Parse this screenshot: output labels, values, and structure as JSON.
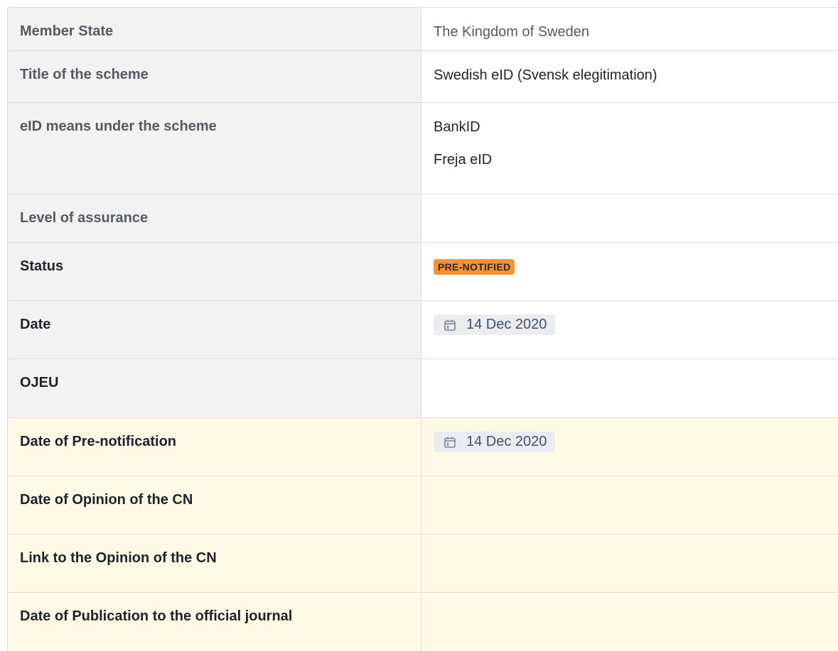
{
  "rows": [
    {
      "label": "Member State",
      "values": [
        "The Kingdom of Sweden"
      ]
    },
    {
      "label": "Title of the scheme",
      "values": [
        "Swedish eID (Svensk elegitimation)"
      ]
    },
    {
      "label": "eID means under the scheme",
      "values": [
        "BankID",
        "Freja eID"
      ]
    },
    {
      "label": "Level of assurance",
      "values": []
    },
    {
      "label": "Status",
      "status": "PRE-NOTIFIED"
    },
    {
      "label": "Date",
      "date": "14 Dec 2020"
    },
    {
      "label": "OJEU",
      "values": []
    },
    {
      "label": "Date of Pre-notification",
      "date": "14 Dec 2020"
    },
    {
      "label": "Date of Opinion of the CN",
      "values": []
    },
    {
      "label": "Link to the Opinion of the CN",
      "values": []
    },
    {
      "label": "Date of Publication to the official journal",
      "values": []
    }
  ],
  "colors": {
    "status_lozenge": "#f79232",
    "header_cell_bg": "#f2f2f2",
    "highlight_row_bg": "#fffae6",
    "date_chip_bg": "#ebecf0"
  },
  "icons": {
    "date": "calendar-icon"
  }
}
